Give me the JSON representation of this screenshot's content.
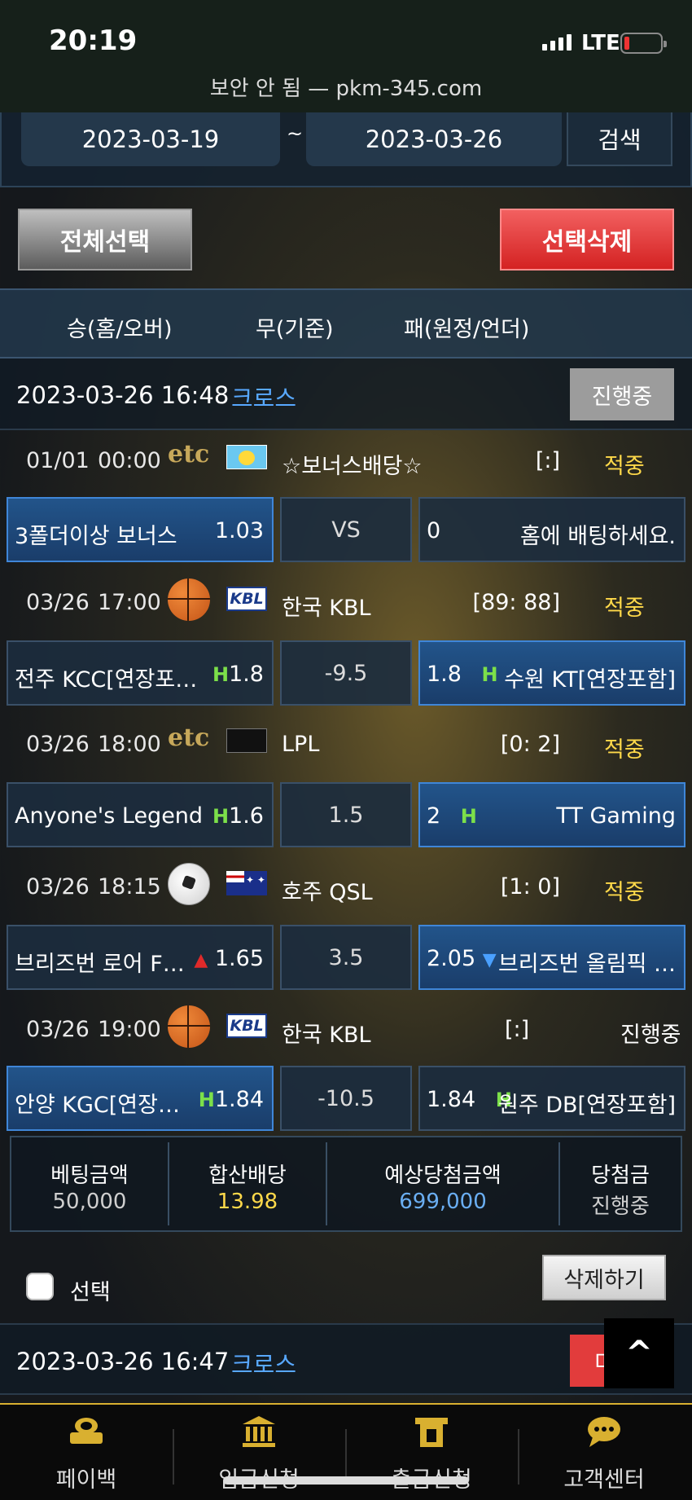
{
  "status_bar": {
    "time": "20:19",
    "network": "LTE",
    "url": "보안 안 됨 — pkm-345.com"
  },
  "search": {
    "date_from": "2023-03-19",
    "separator": "~",
    "date_to": "2023-03-26",
    "button": "검색"
  },
  "actions": {
    "select_all": "전체선택",
    "delete_selected": "선택삭제"
  },
  "columns": {
    "win": "승(홈/오버)",
    "draw": "무(기준)",
    "lose": "패(원정/언더)"
  },
  "bets": [
    {
      "datetime": "2023-03-26 16:48",
      "type": "크로스",
      "status": "진행중",
      "games": [
        {
          "date": "01/01",
          "time": "00:00",
          "sport": "etc",
          "league_icon": "pikachu-flag-icon",
          "league": "☆보너스배당☆",
          "score": "[:]",
          "result": "적중",
          "home": "3폴더이상 보너스",
          "home_odds": "1.03",
          "mid": "VS",
          "away_odds": "0",
          "away": "홈에 배팅하세요.",
          "selected": "home",
          "home_mark": "",
          "away_mark": ""
        },
        {
          "date": "03/26",
          "time": "17:00",
          "sport": "basketball",
          "league_icon": "kbl-logo-icon",
          "league": "한국 KBL",
          "score": "[89: 88]",
          "result": "적중",
          "home": "전주 KCC[연장포…",
          "home_odds": "1.8",
          "mid": "-9.5",
          "away_odds": "1.8",
          "away": "수원 KT[연장포함]",
          "selected": "away",
          "home_mark": "H",
          "away_mark": "H"
        },
        {
          "date": "03/26",
          "time": "18:00",
          "sport": "etc",
          "league_icon": "empty-flag-icon",
          "league": "LPL",
          "score": "[0: 2]",
          "result": "적중",
          "home": "Anyone's Legend",
          "home_odds": "1.6",
          "mid": "1.5",
          "away_odds": "2",
          "away": "TT Gaming",
          "selected": "away",
          "home_mark": "H",
          "away_mark": "H"
        },
        {
          "date": "03/26",
          "time": "18:15",
          "sport": "soccer",
          "league_icon": "australia-flag-icon",
          "league": "호주 QSL",
          "score": "[1: 0]",
          "result": "적중",
          "home": "브리즈번 로어 F…",
          "home_odds": "1.65",
          "mid": "3.5",
          "away_odds": "2.05",
          "away": "브리즈번 올림픽 …",
          "selected": "away",
          "home_mark": "▲",
          "away_mark": "▼"
        },
        {
          "date": "03/26",
          "time": "19:00",
          "sport": "basketball",
          "league_icon": "kbl-logo-icon",
          "league": "한국 KBL",
          "score": "[:]",
          "result": "진행중",
          "home": "안양 KGC[연장…",
          "home_odds": "1.84",
          "mid": "-10.5",
          "away_odds": "1.84",
          "away": "원주 DB[연장포함]",
          "selected": "home",
          "home_mark": "H",
          "away_mark": "H"
        }
      ],
      "summary": {
        "bet_amount_label": "베팅금액",
        "bet_amount": "50,000",
        "total_odds_label": "합산배당",
        "total_odds": "13.98",
        "expected_label": "예상당첨금액",
        "expected": "699,000",
        "winnings_label": "당첨금",
        "winnings": "진행중"
      }
    }
  ],
  "select_row": {
    "label": "선택",
    "delete_button": "삭제하기"
  },
  "next_bet": {
    "datetime": "2023-03-26 16:47",
    "type": "크로스",
    "status": "미"
  },
  "scroll_top": "^",
  "kbl_text": "KBL",
  "etc_text": "etc",
  "nav": [
    {
      "label": "페이백",
      "icon": "coin-stack-icon"
    },
    {
      "label": "입금신청",
      "icon": "bank-icon"
    },
    {
      "label": "출금신청",
      "icon": "wallet-icon"
    },
    {
      "label": "고객센터",
      "icon": "chat-bubble-icon"
    }
  ],
  "colors": {
    "accent_yellow": "#ffd94a",
    "link_blue": "#58a8ff",
    "selected_blue": "#22548a",
    "delete_red": "#d42222",
    "nav_gold": "#d9b030"
  }
}
